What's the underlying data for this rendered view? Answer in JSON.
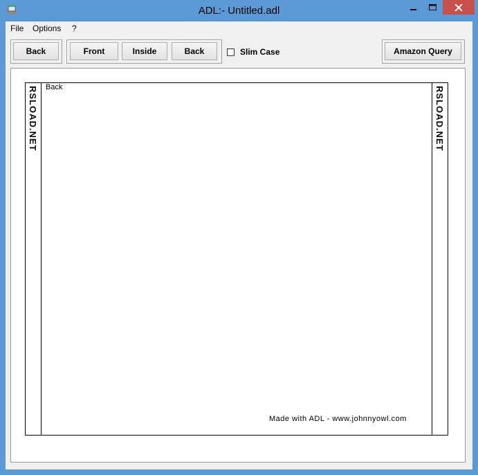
{
  "window": {
    "title": "ADL:- Untitled.adl"
  },
  "menu": [
    "File",
    "Options",
    "?"
  ],
  "toolbar": {
    "back_left": "Back",
    "front": "Front",
    "inside": "Inside",
    "back": "Back",
    "slim_case": "Slim Case",
    "slim_case_checked": false,
    "amazon_query": "Amazon Query"
  },
  "cover": {
    "spine_left": "RSLOAD.NET",
    "spine_right": "RSLOAD.NET",
    "label": "Back",
    "credit": "Made with ADL - www.johnnyowl.com"
  },
  "icons": [
    "app-icon",
    "minimize-icon",
    "maximize-icon",
    "close-icon",
    "checkbox-icon"
  ],
  "colors": {
    "titlebar": "#5b9ad6",
    "close_button": "#c7504a",
    "client": "#f0f0f0"
  }
}
